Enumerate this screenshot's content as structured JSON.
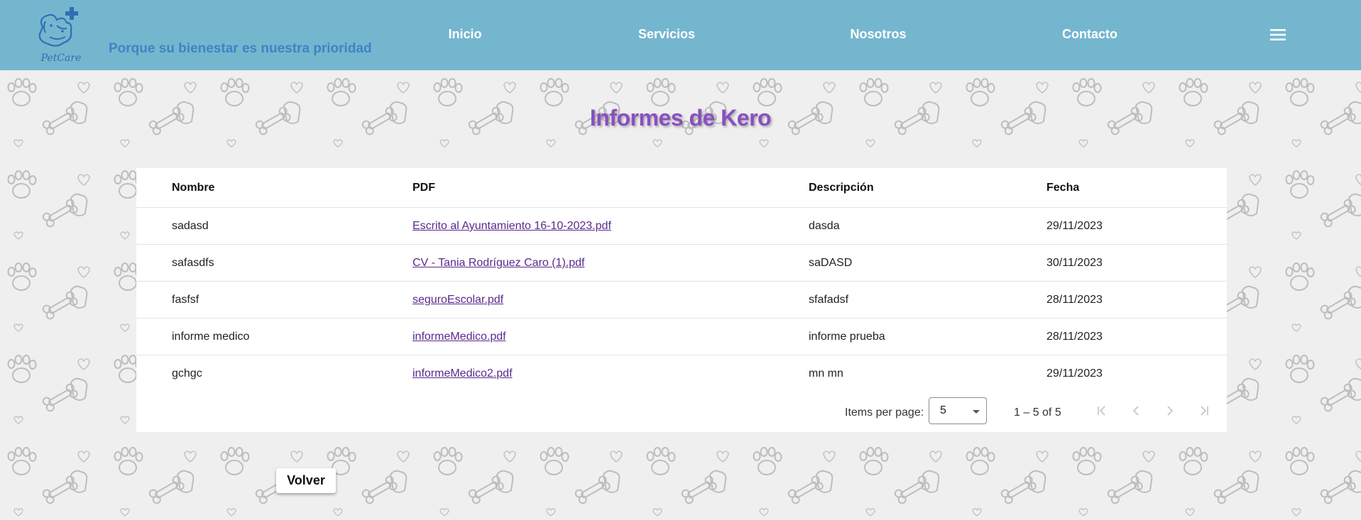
{
  "header": {
    "logo_text": "PetCare",
    "slogan": "Porque su bienestar es nuestra prioridad",
    "nav": [
      "Inicio",
      "Servicios",
      "Nosotros",
      "Contacto"
    ],
    "menu_icon": "hamburger-menu-icon"
  },
  "page": {
    "title": "Informes de Kero"
  },
  "table": {
    "columns": [
      "Nombre",
      "PDF",
      "Descripción",
      "Fecha"
    ],
    "rows": [
      {
        "nombre": "sadasd",
        "pdf": "Escrito al Ayuntamiento 16-10-2023.pdf",
        "descripcion": "dasda",
        "fecha": "29/11/2023"
      },
      {
        "nombre": "safasdfs",
        "pdf": "CV - Tania Rodríguez Caro (1).pdf",
        "descripcion": "saDASD",
        "fecha": "30/11/2023"
      },
      {
        "nombre": "fasfsf",
        "pdf": "seguroEscolar.pdf",
        "descripcion": "sfafadsf",
        "fecha": "28/11/2023"
      },
      {
        "nombre": "informe medico",
        "pdf": "informeMedico.pdf",
        "descripcion": "informe prueba",
        "fecha": "28/11/2023"
      },
      {
        "nombre": "gchgc",
        "pdf": "informeMedico2.pdf",
        "descripcion": "mn mn",
        "fecha": "29/11/2023"
      }
    ]
  },
  "paginator": {
    "items_per_page_label": "Items per page:",
    "items_per_page_value": "5",
    "range_label": "1 – 5 of 5"
  },
  "actions": {
    "volver_label": "Volver"
  },
  "colors": {
    "header_bg": "#75b6cf",
    "nav_text": "#ffffff",
    "slogan": "#3e84c4",
    "title": "#8a4fc2",
    "link": "#5a2a8c"
  }
}
